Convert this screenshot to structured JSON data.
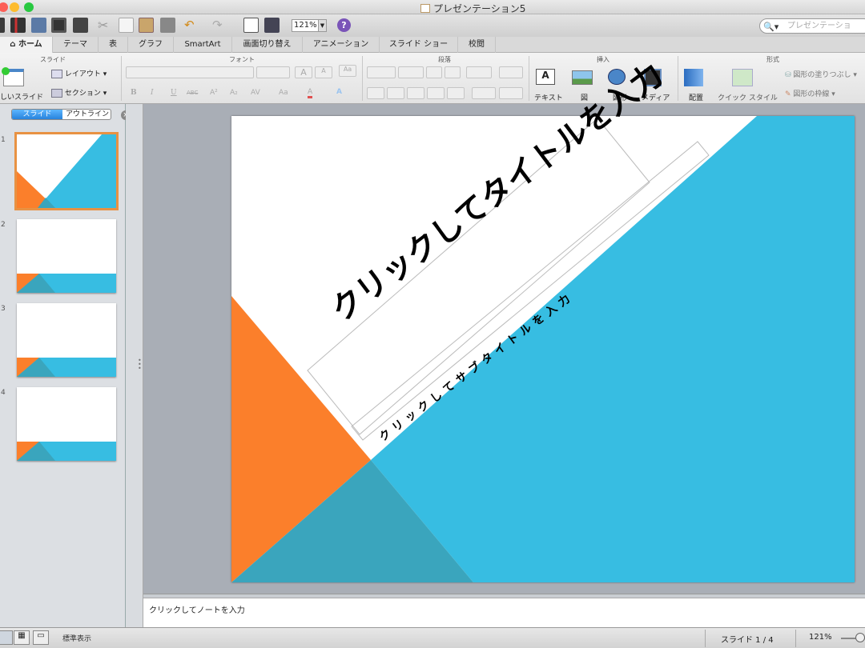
{
  "window": {
    "title": "プレゼンテーション5"
  },
  "toolbar": {
    "zoom": "121%",
    "help": "?",
    "search_placeholder": "プレゼンテーショ"
  },
  "tabs": [
    "ホーム",
    "テーマ",
    "表",
    "グラフ",
    "SmartArt",
    "画面切り替え",
    "アニメーション",
    "スライド ショー",
    "校閲"
  ],
  "groups": {
    "slides": "スライド",
    "font": "フォント",
    "paragraph": "段落",
    "insert": "挿入",
    "format": "形式"
  },
  "ribbon": {
    "new_slide": "しいスライド",
    "layout": "レイアウト",
    "section": "セクション",
    "text": "テキスト",
    "picture": "図",
    "shape": "図形",
    "media": "メディア",
    "arrange": "配置",
    "quick_style": "クイック スタイル",
    "fill": "図形の塗りつぶし",
    "outline": "図形の枠線",
    "bold": "B",
    "italic": "I",
    "underline": "U",
    "strike": "ABC",
    "superscript": "A²",
    "subscript": "A₂",
    "grow": "A",
    "shrink": "A",
    "clear": "Aa",
    "charspace": "AV",
    "case": "Aa",
    "fontcolor": "A",
    "texteffect": "A"
  },
  "side_tabs": {
    "slides": "スライド",
    "outline": "アウトライン"
  },
  "thumbnails": [
    {
      "num": "1"
    },
    {
      "num": "2"
    },
    {
      "num": "3"
    },
    {
      "num": "4"
    }
  ],
  "slide": {
    "title": "クリックしてタイトルを入力",
    "subtitle": "クリックしてサブタイトルを入力"
  },
  "notes": "クリックしてノートを入力",
  "status": {
    "view": "標準表示",
    "slide_count": "スライド 1 / 4",
    "zoom": "121%"
  },
  "colors": {
    "accent_orange": "#fb7f2b",
    "accent_blue": "#37bde2",
    "overlap": "#3aa5bd"
  }
}
